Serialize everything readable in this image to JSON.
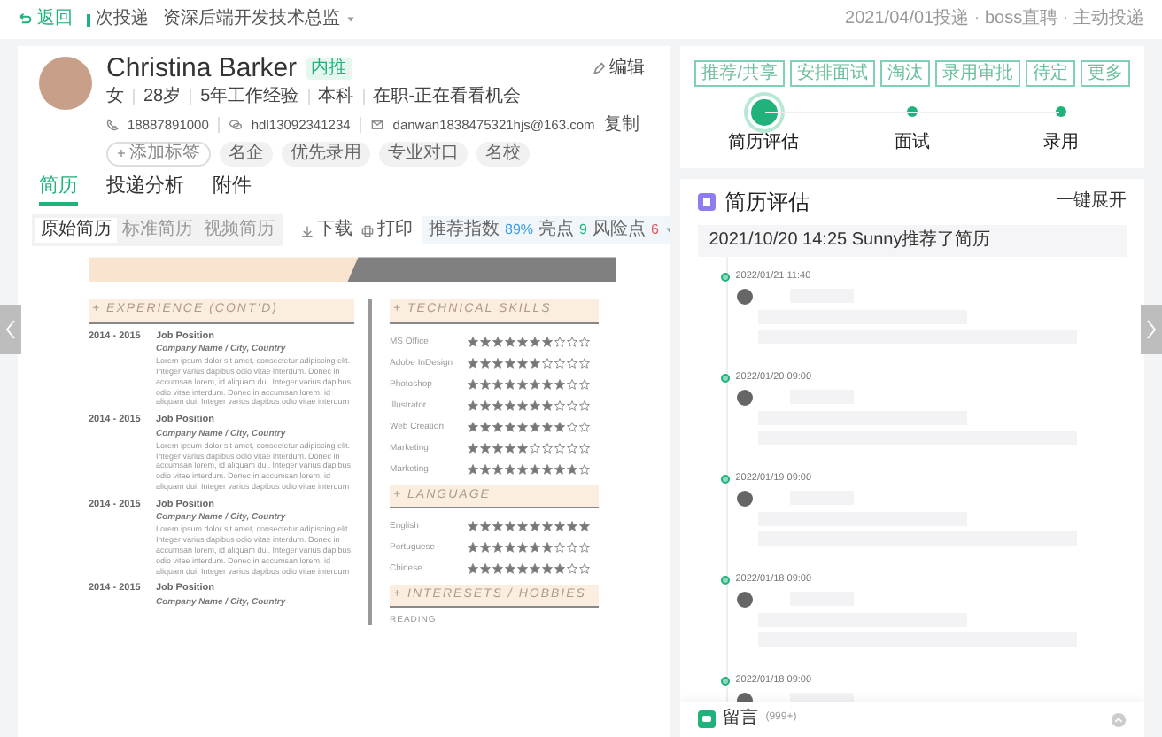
{
  "top_bar": {
    "back": "返回",
    "channel": "次投递",
    "job_title": "资深后端开发技术总监",
    "delivery_info": "2021/04/01投递 · boss直聘 · 主动投递"
  },
  "candidate": {
    "name": "Christina Barker",
    "badge": "内推",
    "edit": "编辑",
    "info": [
      "女",
      "28岁",
      "5年工作经验",
      "本科",
      "在职-正在看看机会"
    ],
    "phone": "18887891000",
    "wechat": "hdl13092341234",
    "email": "danwan1838475321hjs@163.com",
    "copy": "复制",
    "add_tag": "添加标签",
    "tags": [
      "名企",
      "优先录用",
      "专业对口",
      "名校"
    ]
  },
  "tabs": [
    {
      "label": "简历",
      "selected": true
    },
    {
      "label": "投递分析",
      "selected": false
    },
    {
      "label": "附件",
      "selected": false
    }
  ],
  "resume_views": [
    {
      "label": "原始简历",
      "selected": true
    },
    {
      "label": "标准简历",
      "selected": false
    },
    {
      "label": "视频简历",
      "selected": false
    }
  ],
  "toolbar": {
    "download": "下载",
    "print": "打印",
    "scores": [
      {
        "label": "推荐指数",
        "value": "89%",
        "color": "#3a9ee8"
      },
      {
        "label": "亮点",
        "value": "9",
        "color": "#22b573"
      },
      {
        "label": "风险点",
        "value": "6",
        "color": "#e85a5a"
      }
    ]
  },
  "resume": {
    "experience_title": "+ EXPERIENCE (CONT'D)",
    "experience": [
      {
        "period": "2014 - 2015",
        "position": "Job Position",
        "company": "Company Name / City, Country",
        "description": "Lorem ipsum dolor sit amet, consectetur adipiscing elit. Integer varius dapibus odio vitae interdum. Donec in accumsan lorem, id aliquam dui. Integer varius dapibus odio vitae interdum. Donec in accumsan lorem, id aliquam dui. Integer varius dapibus odio vitae interdum"
      },
      {
        "period": "2014 - 2015",
        "position": "Job Position",
        "company": "Company Name / City, Country",
        "description": "Lorem ipsum dolor sit amet, consectetur adipiscing elit. Integer varius dapibus odio vitae interdum. Donec in accumsan lorem, id aliquam dui. Integer varius dapibus odio vitae interdum. Donec in accumsan lorem, id aliquam dui. Integer varius dapibus odio vitae interdum"
      },
      {
        "period": "2014 - 2015",
        "position": "Job Position",
        "company": "Company Name / City, Country",
        "description": "Lorem ipsum dolor sit amet, consectetur adipiscing elit. Integer varius dapibus odio vitae interdum. Donec in accumsan lorem, id aliquam dui. Integer varius dapibus odio vitae interdum. Donec in accumsan lorem, id aliquam dui. Integer varius dapibus odio vitae interdum"
      },
      {
        "period": "2014 - 2015",
        "position": "Job Position",
        "company": "Company Name / City, Country"
      }
    ],
    "skills_title": "+ TECHNICAL SKILLS",
    "skills": [
      {
        "name": "MS Office",
        "stars": 7
      },
      {
        "name": "Adobe InDesign",
        "stars": 6
      },
      {
        "name": "Photoshop",
        "stars": 8
      },
      {
        "name": "Illustrator",
        "stars": 7
      },
      {
        "name": "Web Creation",
        "stars": 8
      },
      {
        "name": "Marketing",
        "stars": 5
      },
      {
        "name": "Marketing",
        "stars": 9
      }
    ],
    "language_title": "+ LANGUAGE",
    "languages": [
      {
        "name": "English",
        "stars": 10
      },
      {
        "name": "Portuguese",
        "stars": 7
      },
      {
        "name": "Chinese",
        "stars": 8
      }
    ],
    "hobbies_title": "+ INTERESETS / HOBBIES",
    "hobbies": [
      "READING"
    ]
  },
  "actions": [
    "推荐/共享",
    "安排面试",
    "淘汰",
    "录用审批",
    "待定",
    "更多"
  ],
  "stages": [
    {
      "label": "简历评估",
      "selected": true
    },
    {
      "label": "面试",
      "selected": false
    },
    {
      "label": "录用",
      "selected": false
    }
  ],
  "evaluation": {
    "title": "简历评估",
    "expand": "一键展开",
    "summary": "2021/10/20 14:25   Sunny推荐了简历",
    "entries": [
      {
        "time": "2022/01/21 11:40"
      },
      {
        "time": "2022/01/20 09:00"
      },
      {
        "time": "2022/01/19 09:00"
      },
      {
        "time": "2022/01/18 09:00"
      },
      {
        "time": "2022/01/18 09:00"
      }
    ]
  },
  "comments": {
    "label": "留言",
    "count": "(999+)"
  }
}
